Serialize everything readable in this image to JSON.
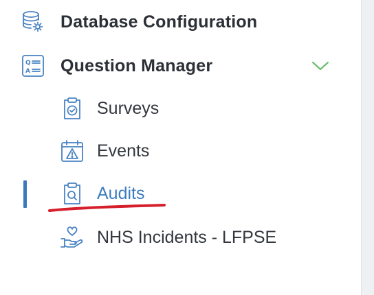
{
  "sidebar": {
    "items": [
      {
        "label": "Database Configuration",
        "icon": "database-gear-icon"
      },
      {
        "label": "Question Manager",
        "icon": "qa-list-icon",
        "expanded": true,
        "children": [
          {
            "label": "Surveys",
            "icon": "clipboard-check-icon"
          },
          {
            "label": "Events",
            "icon": "calendar-warning-icon"
          },
          {
            "label": "Audits",
            "icon": "clipboard-search-icon",
            "active": true
          },
          {
            "label": "NHS Incidents - LFPSE",
            "icon": "hand-heart-icon"
          }
        ]
      }
    ]
  },
  "colors": {
    "icon_blue": "#4a82c3",
    "active_text": "#3d7cc0",
    "active_bar": "#3d78bf",
    "chevron": "#6cc06c",
    "annotation_red": "#d61f2c"
  }
}
